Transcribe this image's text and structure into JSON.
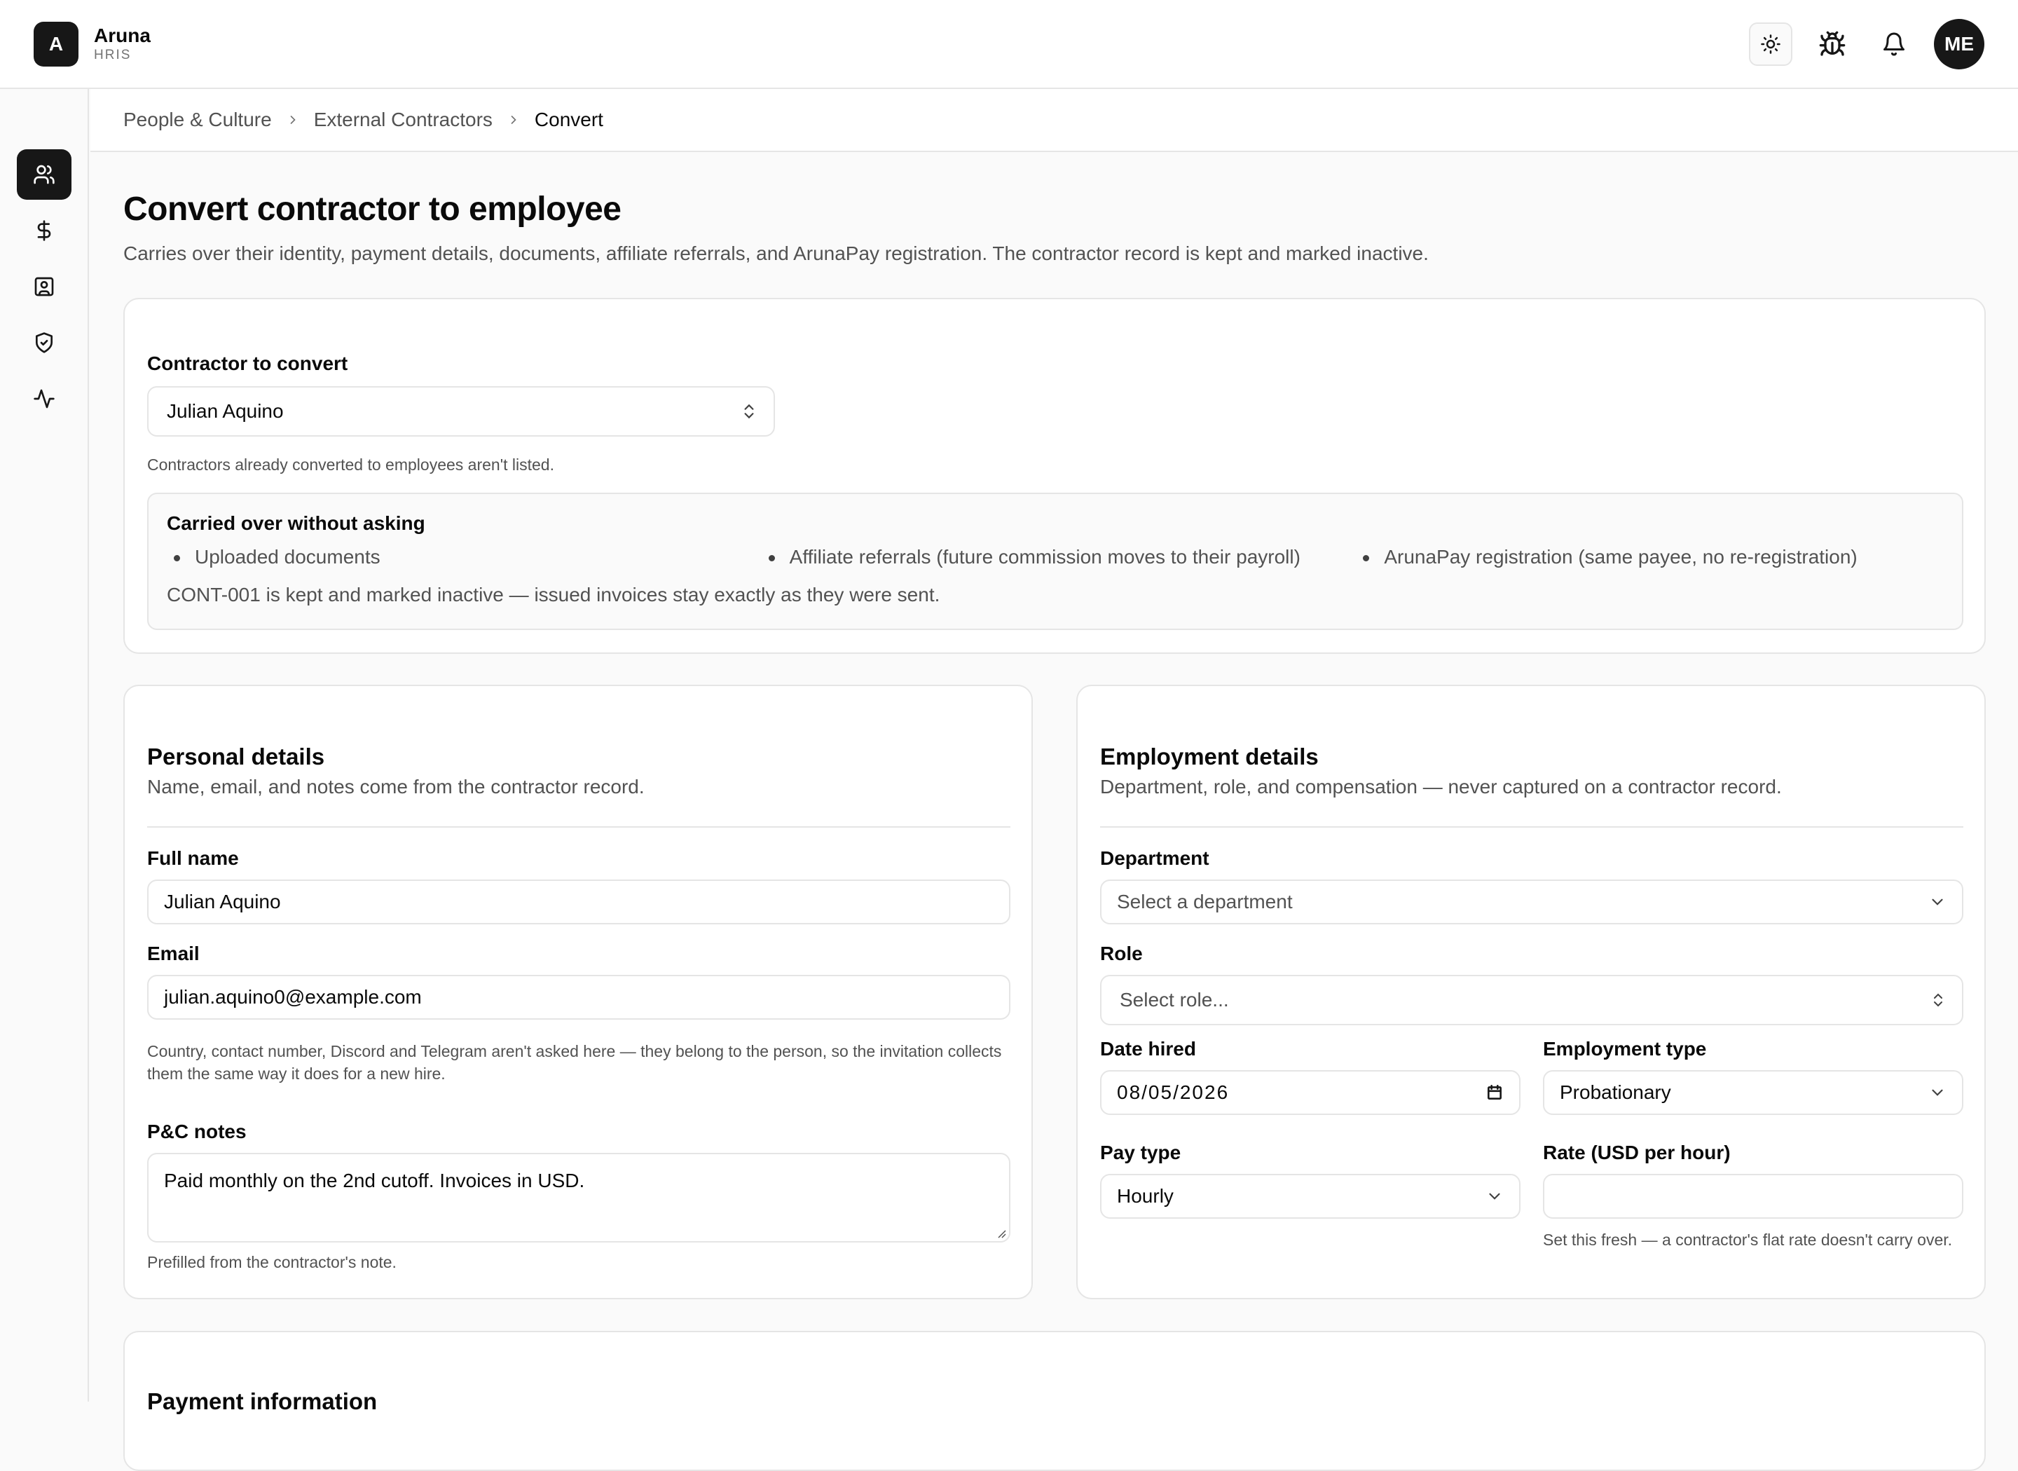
{
  "app": {
    "brand_initial": "A",
    "brand_name": "Aruna",
    "brand_sub": "HRIS",
    "user_initials": "ME"
  },
  "topbar": {
    "icons": [
      "sun-icon",
      "bug-icon",
      "bell-icon"
    ]
  },
  "sidebar": {
    "items": [
      {
        "icon": "users-icon",
        "active": true
      },
      {
        "icon": "dollar-icon",
        "active": false
      },
      {
        "icon": "contact-card-icon",
        "active": false
      },
      {
        "icon": "shield-check-icon",
        "active": false
      },
      {
        "icon": "activity-icon",
        "active": false
      }
    ]
  },
  "breadcrumb": {
    "items": [
      "People & Culture",
      "External Contractors"
    ],
    "current": "Convert"
  },
  "page": {
    "title": "Convert contractor to employee",
    "subtitle": "Carries over their identity, payment details, documents, affiliate referrals, and ArunaPay registration. The contractor record is kept and marked inactive."
  },
  "contractor": {
    "label": "Contractor to convert",
    "value": "Julian Aquino",
    "help": "Contractors already converted to employees aren't listed.",
    "carried_title": "Carried over without asking",
    "carried_items": [
      "Uploaded documents",
      "Affiliate referrals (future commission moves to their payroll)",
      "ArunaPay registration (same payee, no re-registration)"
    ],
    "carried_foot": "CONT-001 is kept and marked inactive — issued invoices stay exactly as they were sent."
  },
  "personal": {
    "title": "Personal details",
    "subtitle": "Name, email, and notes come from the contractor record.",
    "full_name_label": "Full name",
    "full_name_value": "Julian Aquino",
    "email_label": "Email",
    "email_value": "julian.aquino0@example.com",
    "contact_help": "Country, contact number, Discord and Telegram aren't asked here — they belong to the person, so the invitation collects them the same way it does for a new hire.",
    "notes_label": "P&C notes",
    "notes_value": "Paid monthly on the 2nd cutoff. Invoices in USD.",
    "notes_help": "Prefilled from the contractor's note."
  },
  "employment": {
    "title": "Employment details",
    "subtitle": "Department, role, and compensation — never captured on a contractor record.",
    "department_label": "Department",
    "department_placeholder": "Select a department",
    "role_label": "Role",
    "role_placeholder": "Select role...",
    "date_label": "Date hired",
    "date_value": "08/05/2026",
    "type_label": "Employment type",
    "type_value": "Probationary",
    "pay_label": "Pay type",
    "pay_value": "Hourly",
    "rate_label": "Rate (USD per hour)",
    "rate_value": "",
    "rate_help": "Set this fresh — a contractor's flat rate doesn't carry over."
  },
  "payment": {
    "title": "Payment information"
  }
}
